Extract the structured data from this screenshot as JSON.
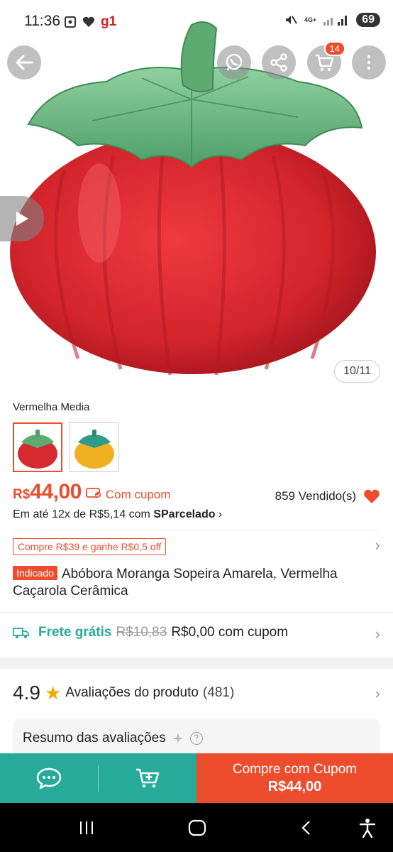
{
  "status_bar": {
    "time": "11:36",
    "app_badge": "g1",
    "network": "4G+",
    "battery": "69"
  },
  "gallery": {
    "counter": "10/11",
    "cart_count": "14"
  },
  "variants": {
    "selected_label": "Vermelha Media",
    "options": [
      {
        "color": "#d62a2e",
        "state": "selected"
      },
      {
        "color": "#f0b020",
        "state": "unselected"
      }
    ]
  },
  "price": {
    "currency": "R$",
    "value": "44,00",
    "coupon_text": "Com cupom",
    "sold_text": "859 Vendido(s)",
    "installments_prefix": "Em até 12x de R$5,14 com ",
    "installments_brand": "SParcelado",
    "installments_suffix": " ›"
  },
  "promo": {
    "chip": "Compre R$39 e ganhe R$0,5 off"
  },
  "product": {
    "tag": "Indicado",
    "title": "Abóbora Moranga Sopeira Amarela,  Vermelha Caçarola Cerâmica"
  },
  "shipping": {
    "label": "Frete grátis",
    "old_price": "R$10,83",
    "new_price": "R$0,00 com cupom"
  },
  "reviews": {
    "score": "4.9",
    "label": "Avaliações do produto",
    "count": "(481)",
    "summary_title": "Resumo das avaliações"
  },
  "actions": {
    "buy_label": "Compre com Cupom",
    "buy_price": "R$44,00"
  },
  "colors": {
    "accent": "#ee4d2d",
    "teal": "#26aa99"
  }
}
